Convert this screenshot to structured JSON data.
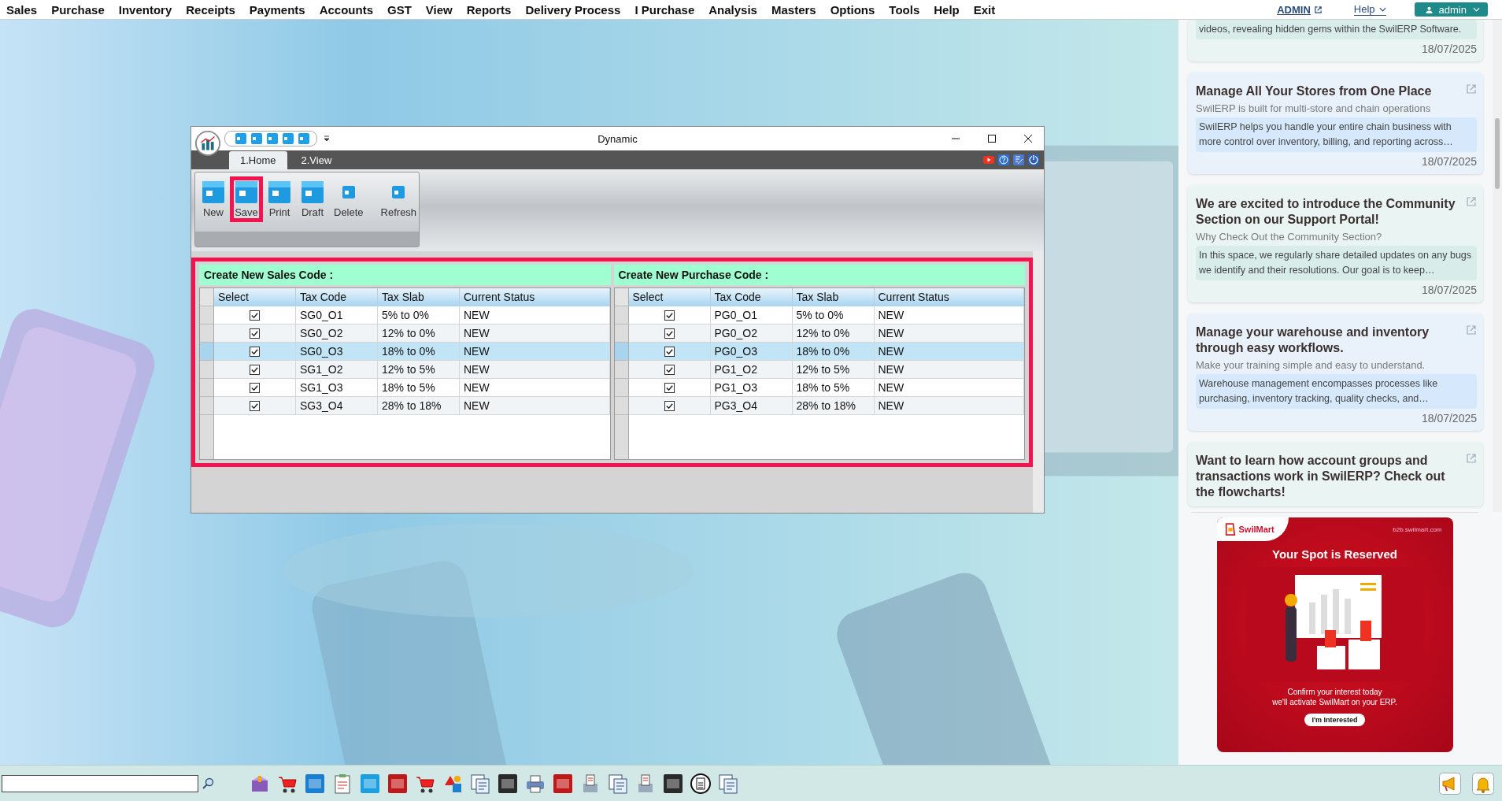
{
  "menu_bar": {
    "items": [
      "Sales",
      "Purchase",
      "Inventory",
      "Receipts",
      "Payments",
      "Accounts",
      "GST",
      "View",
      "Reports",
      "Delivery Process",
      "I Purchase",
      "Analysis",
      "Masters",
      "Options",
      "Tools",
      "Help",
      "Exit"
    ],
    "admin_link": "ADMIN",
    "help_menu": "Help",
    "user_button": "admin"
  },
  "window": {
    "title": "Dynamic",
    "tabs": [
      {
        "label": "1.Home",
        "selected": true
      },
      {
        "label": "2.View",
        "selected": false
      }
    ],
    "ribbon": [
      {
        "label": "New",
        "kind": "large",
        "highlighted": false
      },
      {
        "label": "Save",
        "kind": "large",
        "highlighted": true
      },
      {
        "label": "Print",
        "kind": "large",
        "highlighted": false
      },
      {
        "label": "Draft",
        "kind": "large",
        "highlighted": false
      },
      {
        "label": "Delete",
        "kind": "small",
        "highlighted": false
      },
      {
        "label": "Refresh",
        "kind": "small",
        "highlighted": false
      }
    ],
    "grid_area": {
      "highlighted": true,
      "panels": [
        {
          "title": "Create New Sales Code :",
          "columns": [
            "Select",
            "Tax Code",
            "Tax Slab",
            "Current Status"
          ],
          "rows": [
            {
              "checked": true,
              "selected": false,
              "cells": [
                "",
                "SG0_O1",
                "5% to 0%",
                "NEW"
              ]
            },
            {
              "checked": true,
              "selected": false,
              "cells": [
                "",
                "SG0_O2",
                "12% to 0%",
                "NEW"
              ]
            },
            {
              "checked": true,
              "selected": true,
              "cells": [
                "",
                "SG0_O3",
                "18% to 0%",
                "NEW"
              ]
            },
            {
              "checked": true,
              "selected": false,
              "cells": [
                "",
                "SG1_O2",
                "12% to 5%",
                "NEW"
              ]
            },
            {
              "checked": true,
              "selected": false,
              "cells": [
                "",
                "SG1_O3",
                "18% to 5%",
                "NEW"
              ]
            },
            {
              "checked": true,
              "selected": false,
              "cells": [
                "",
                "SG3_O4",
                "28% to 18%",
                "NEW"
              ]
            }
          ]
        },
        {
          "title": "Create New Purchase Code :",
          "columns": [
            "Select",
            "Tax Code",
            "Tax Slab",
            "Current Status"
          ],
          "rows": [
            {
              "checked": true,
              "selected": false,
              "cells": [
                "",
                "PG0_O1",
                "5% to 0%",
                "NEW"
              ]
            },
            {
              "checked": true,
              "selected": false,
              "cells": [
                "",
                "PG0_O2",
                "12% to 0%",
                "NEW"
              ]
            },
            {
              "checked": true,
              "selected": true,
              "cells": [
                "",
                "PG0_O3",
                "18% to 0%",
                "NEW"
              ]
            },
            {
              "checked": true,
              "selected": false,
              "cells": [
                "",
                "PG1_O2",
                "12% to 5%",
                "NEW"
              ]
            },
            {
              "checked": true,
              "selected": false,
              "cells": [
                "",
                "PG1_O3",
                "18% to 5%",
                "NEW"
              ]
            },
            {
              "checked": true,
              "selected": false,
              "cells": [
                "",
                "PG3_O4",
                "28% to 18%",
                "NEW"
              ]
            }
          ]
        }
      ]
    }
  },
  "news_feed": {
    "items": [
      {
        "summary": "videos, revealing hidden gems within the SwilERP Software.",
        "date": "18/07/2025"
      },
      {
        "title": "Manage All Your Stores from One Place",
        "subtitle": "SwilERP is built for multi-store and chain operations",
        "summary": "SwilERP helps you handle your entire chain business with more control over inventory, billing, and reporting across…",
        "date": "18/07/2025"
      },
      {
        "title": "We are excited to introduce the Community Section on our Support Portal!",
        "subtitle": "Why Check Out the Community Section?",
        "summary": "In this space, we regularly share detailed updates on any bugs we identify and their resolutions. Our goal is to keep…",
        "date": "18/07/2025"
      },
      {
        "title": "Manage your warehouse and inventory through easy workflows.",
        "subtitle": "Make your training simple and easy to understand.",
        "summary": "Warehouse management encompasses processes like purchasing, inventory tracking, quality checks, and…",
        "date": "18/07/2025"
      },
      {
        "title": "Want to learn how account groups and transactions work in SwilERP? Check out the flowcharts!"
      }
    ]
  },
  "promo": {
    "brand": "SwilMart",
    "url": "b2b.swilmart.com",
    "heading": "Your Spot is Reserved",
    "lines": [
      "Confirm your interest today",
      "we'll activate SwilMart on your ERP."
    ],
    "button": "I'm Interested"
  }
}
